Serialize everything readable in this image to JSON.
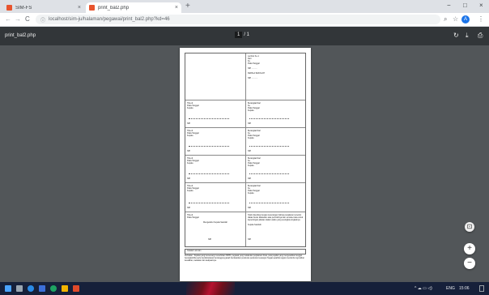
{
  "browser": {
    "tabs": [
      {
        "label": "SIM-FS",
        "close": "×"
      },
      {
        "label": "print_bal2.php",
        "close": "×"
      }
    ],
    "new_tab": "+",
    "window_controls": [
      "−",
      "□",
      "×"
    ],
    "nav": {
      "back": "←",
      "forward": "→",
      "reload": "C"
    },
    "url": "localhost/sim-ju/halaman/pegawai/print_bal2.php?kd=46",
    "lock": "ⓘ",
    "zoom_icon": "⌕",
    "star_icon": "☆",
    "profile_initial": "A",
    "menu_icon": "⋮"
  },
  "pdf": {
    "title": "print_bal2.php",
    "page_current": "1",
    "page_total": "/ 1",
    "rotate_icon": "↻",
    "download_icon": "⤓",
    "print_icon": "⎙"
  },
  "document": {
    "cells": [
      {
        "lines": [
          "",
          "",
          "",
          "",
          ""
        ]
      },
      {
        "lines": [
          "Lembar Ke-1",
          "Dari",
          "Ke",
          "Pada Tanggal",
          "",
          "NIP. ..........",
          "",
          "KEPALA SEKOLAH",
          "",
          "NIP. ..........."
        ]
      },
      {
        "lines": [
          "Tiba di",
          "Pada Tanggal",
          "Kepala",
          "",
          "",
          "",
          "NIP."
        ]
      },
      {
        "lines": [
          "Berangkat Dari",
          "Ke",
          "Pada Tanggal",
          "Kepala",
          "",
          "",
          "NIP."
        ]
      },
      {
        "lines": [
          "Tiba di",
          "Pada Tanggal",
          "Kepala",
          "",
          "",
          "",
          "NIP."
        ]
      },
      {
        "lines": [
          "Berangkat Dari",
          "Ke",
          "Pada Tanggal",
          "Kepala",
          "",
          "",
          "NIP."
        ]
      },
      {
        "lines": [
          "Tiba di",
          "Pada Tanggal",
          "Kepala",
          "",
          "",
          "",
          "NIP."
        ]
      },
      {
        "lines": [
          "Berangkat Dari",
          "Ke",
          "Pada Tanggal",
          "Kepala",
          "",
          "",
          "NIP."
        ]
      },
      {
        "lines": [
          "Tiba di",
          "Pada Tanggal",
          "Kepala",
          "",
          "",
          "",
          "NIP."
        ]
      },
      {
        "lines": [
          "Berangkat Dari",
          "Ke",
          "Pada Tanggal",
          "Kepala",
          "",
          "",
          "NIP."
        ]
      },
      {
        "lines": [
          "Tiba di",
          "Pada Tanggal",
          "",
          "Mengetahui Kepala Sekolah",
          "",
          "",
          "",
          "NIP."
        ]
      },
      {
        "lines": [
          "Telah diperiksa dengan keterangan bahwa perjalanan tersebut diatas benar dilakukan atas perintahnya dan semata-mata untuk kepentingan jabatan dalam waktu yang sesingkat-singkatnya.",
          "",
          "Kepala Sekolah",
          "",
          "",
          "NIP."
        ]
      }
    ],
    "catatan": "Catatan Lain-lain",
    "note": "Perhatian : Pejabat yang berwenang menerbitkan SPPD, pegawai yang melakukan perjalanan dinas, para pejabat yang mengesahkan tanggal berangkat/tiba serta bendaharawan bertanggung jawab berdasarkan peraturan-peraturan keuangan Negara apabila negara menderita rugi akibat kesalahan, kelalaian dan kealpaannya."
  },
  "fabs": {
    "fit": "⊡",
    "zoom_in": "+",
    "zoom_out": "−"
  },
  "taskbar": {
    "start_icon": "windows-icon",
    "tray_time": "15:06",
    "tray_lang": "ENG",
    "tray_icons": "^ ☁ ▭ ◁)"
  }
}
